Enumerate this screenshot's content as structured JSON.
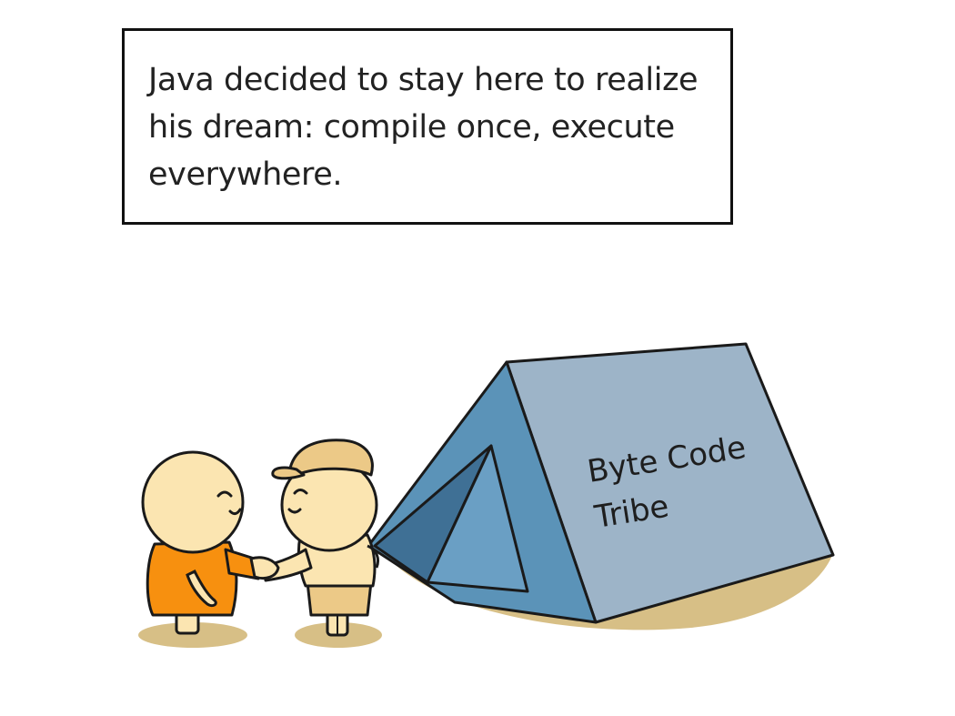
{
  "caption": {
    "text": "Java decided to stay here to realize his dream: compile once, execute everywhere."
  },
  "tent": {
    "label_line1": "Byte Code",
    "label_line2": "Tribe"
  },
  "colors": {
    "tent_side": "#9db4c8",
    "tent_front": "#5b93b8",
    "tent_inner": "#3f7095",
    "ground": "#d7bf86",
    "skin": "#fbe5b1",
    "robe": "#f7900f",
    "cap": "#ecc987",
    "outline": "#1a1a1a"
  }
}
